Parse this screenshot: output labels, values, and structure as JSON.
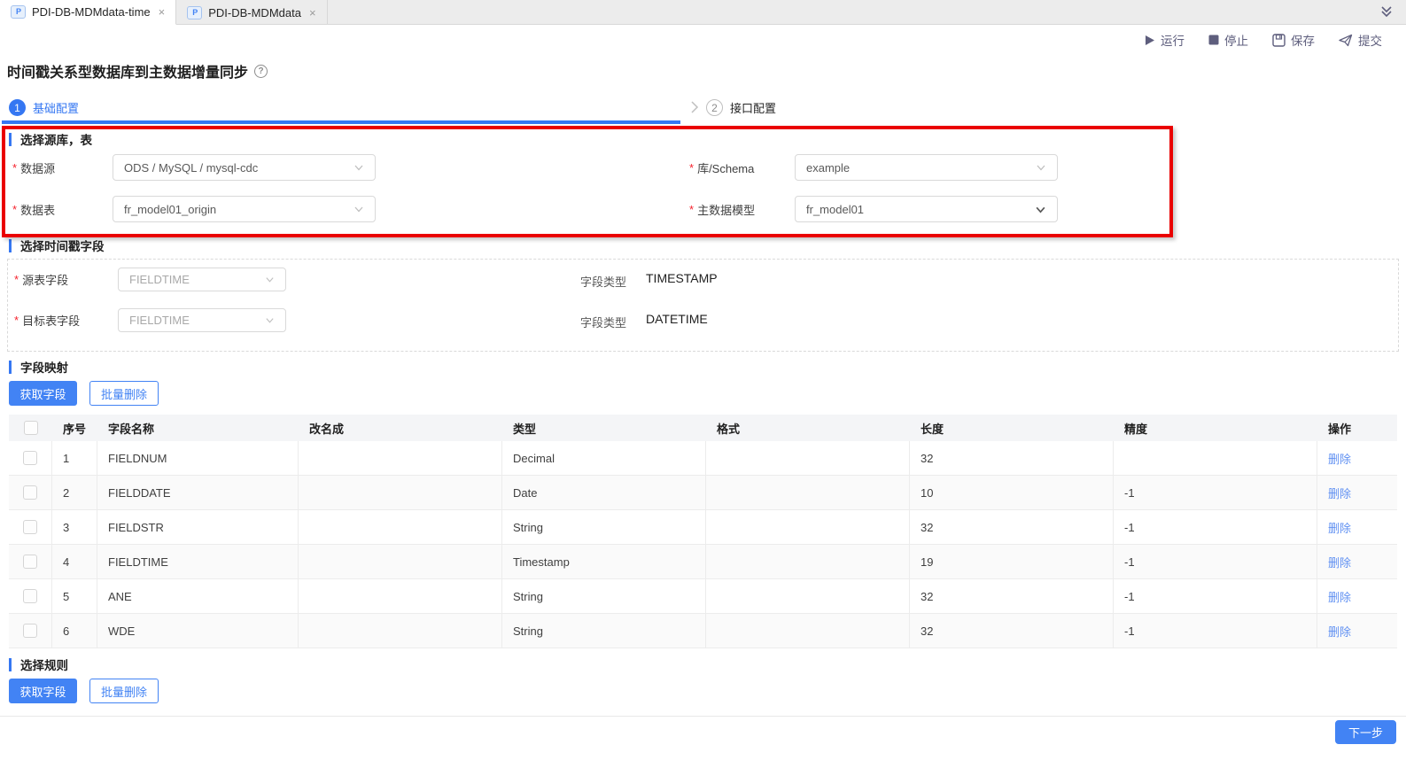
{
  "appearance": {
    "accent_blue": "#3577f2",
    "button_blue": "#4283f4",
    "link_blue": "#6191f2",
    "annotation_red": "#ea0000",
    "toolbar_icon_color": "#5e5e7d"
  },
  "tabbar": {
    "tabs": [
      {
        "label": "PDI-DB-MDMdata-time",
        "close": "×",
        "active": true
      },
      {
        "label": "PDI-DB-MDMdata",
        "close": "×",
        "active": false
      }
    ],
    "file_icon_text": "P"
  },
  "toolbar": {
    "run": "运行",
    "stop": "停止",
    "save": "保存",
    "submit": "提交"
  },
  "page": {
    "title": "时间戳关系型数据库到主数据增量同步",
    "help": "?"
  },
  "steps": [
    {
      "num": "1",
      "label": "基础配置"
    },
    {
      "num": "2",
      "label": "接口配置"
    }
  ],
  "source_section": {
    "title": "选择源库，表",
    "datasource_label": "数据源",
    "datasource_value": "ODS / MySQL / mysql-cdc",
    "schema_label": "库/Schema",
    "schema_value": "example",
    "table_label": "数据表",
    "table_value": "fr_model01_origin",
    "model_label": "主数据模型",
    "model_value": "fr_model01"
  },
  "timestamp_section": {
    "title": "选择时间戳字段",
    "rows": [
      {
        "label": "源表字段",
        "value": "FIELDTIME",
        "type_label": "字段类型",
        "type_value": "TIMESTAMP"
      },
      {
        "label": "目标表字段",
        "value": "FIELDTIME",
        "type_label": "字段类型",
        "type_value": "DATETIME"
      }
    ]
  },
  "mapping_section": {
    "title": "字段映射",
    "get_fields": "获取字段",
    "batch_delete": "批量删除",
    "table": {
      "headers": [
        "序号",
        "字段名称",
        "改名成",
        "类型",
        "格式",
        "长度",
        "精度",
        "操作"
      ],
      "rows": [
        {
          "num": "1",
          "name": "FIELDNUM",
          "rename": "",
          "type": "Decimal",
          "format": "",
          "length": "32",
          "precision": "",
          "action": "删除"
        },
        {
          "num": "2",
          "name": "FIELDDATE",
          "rename": "",
          "type": "Date",
          "format": "",
          "length": "10",
          "precision": "-1",
          "action": "删除"
        },
        {
          "num": "3",
          "name": "FIELDSTR",
          "rename": "",
          "type": "String",
          "format": "",
          "length": "32",
          "precision": "-1",
          "action": "删除"
        },
        {
          "num": "4",
          "name": "FIELDTIME",
          "rename": "",
          "type": "Timestamp",
          "format": "",
          "length": "19",
          "precision": "-1",
          "action": "删除"
        },
        {
          "num": "5",
          "name": "ANE",
          "rename": "",
          "type": "String",
          "format": "",
          "length": "32",
          "precision": "-1",
          "action": "删除"
        },
        {
          "num": "6",
          "name": "WDE",
          "rename": "",
          "type": "String",
          "format": "",
          "length": "32",
          "precision": "-1",
          "action": "删除"
        }
      ]
    }
  },
  "rules_section": {
    "title": "选择规则",
    "get_fields": "获取字段",
    "batch_delete": "批量删除"
  },
  "footer": {
    "next": "下一步"
  }
}
